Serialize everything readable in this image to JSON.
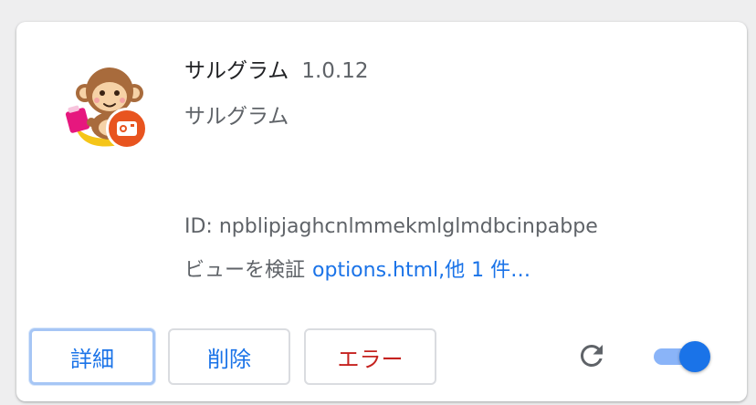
{
  "extension": {
    "name": "サルグラム",
    "version": "1.0.12",
    "description": "サルグラム",
    "id_label": "ID: npblipjaghcnlmmekmlglmdbcinpabpe",
    "inspect_label": "ビューを検証",
    "inspect_link": "options.html,他 1 件…",
    "icon": "monkey-mascot-icon",
    "badge_icon": "record-badge-icon"
  },
  "buttons": {
    "details": "詳細",
    "remove": "削除",
    "errors": "エラー"
  },
  "controls": {
    "reload_icon": "reload-icon",
    "enabled": true
  },
  "colors": {
    "link": "#1a73e8",
    "error": "#c5221f",
    "badge": "#e8541f",
    "toggle_track": "#8ab4f8",
    "toggle_knob": "#1a73e8"
  }
}
